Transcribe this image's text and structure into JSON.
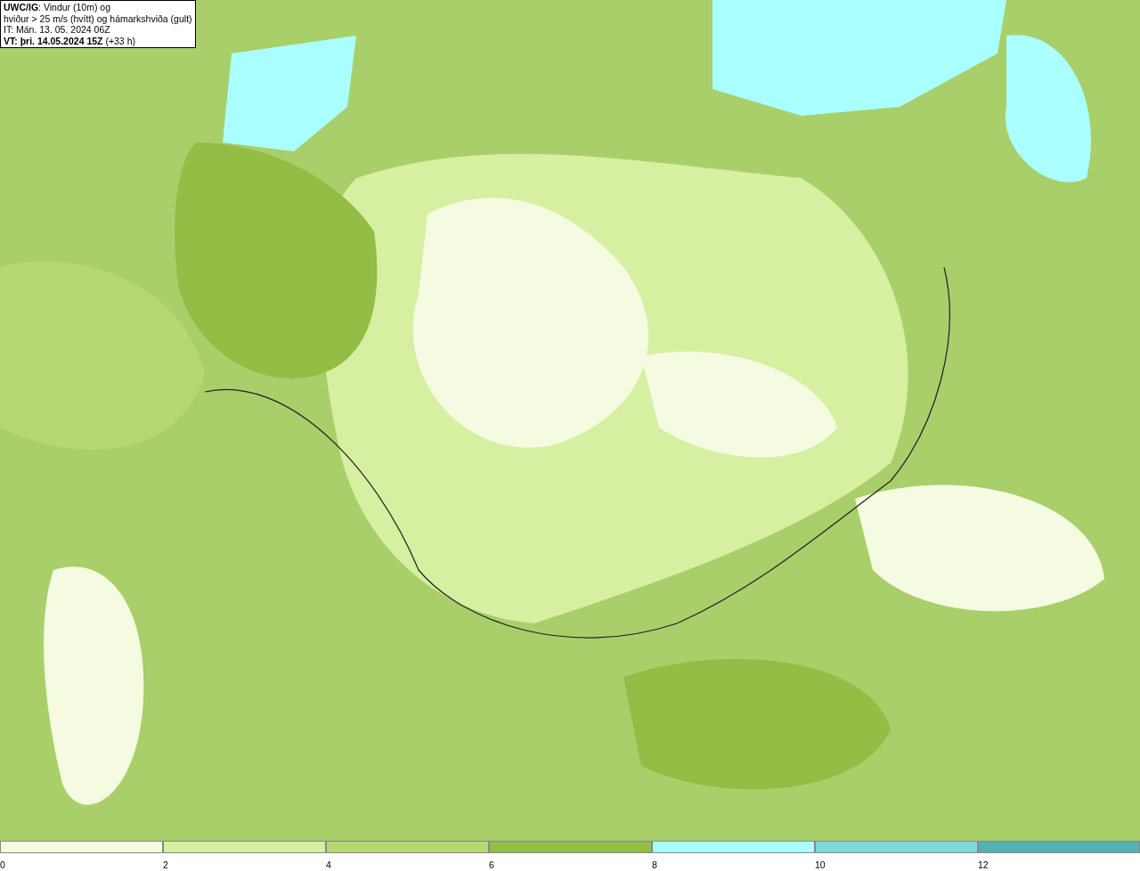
{
  "legend": {
    "lines": [
      "**UWC/IG**: Vindur (10m) og",
      "hviður > 25 m/s (hvítt) og hámarkshviða (gult)",
      "IT: Mán. 13. 05. 2024 06Z",
      "**VT: þri. 14.05.2024 15Z** (+33 h)"
    ]
  },
  "color_bar": [
    {
      "label": "0",
      "color": "#f4fbe0"
    },
    {
      "label": "2",
      "color": "#d6efa0"
    },
    {
      "label": "4",
      "color": "#b5d873"
    },
    {
      "label": "6",
      "color": "#93bd45"
    },
    {
      "label": "8",
      "color": "#aaffff"
    },
    {
      "label": "10",
      "color": "#7fd8d8"
    },
    {
      "label": "12",
      "color": "#52b2b2"
    }
  ]
}
